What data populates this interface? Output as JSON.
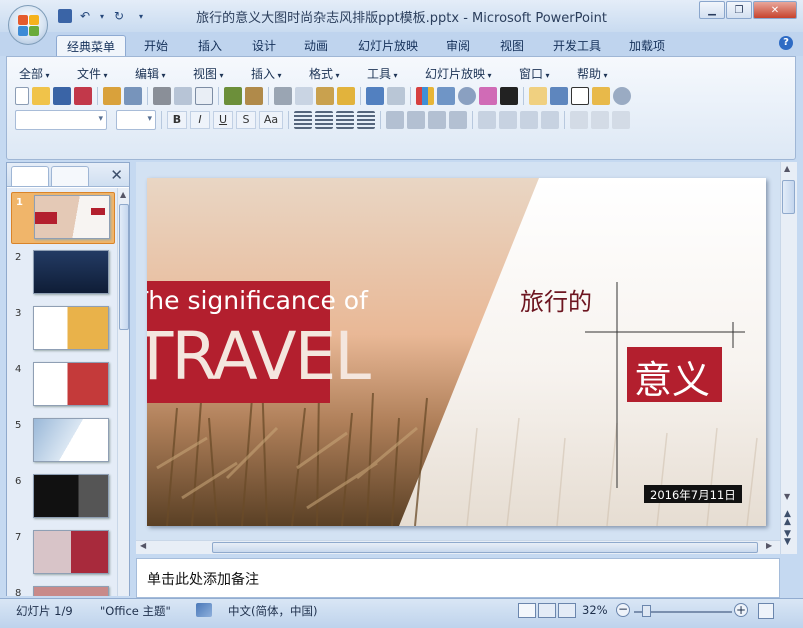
{
  "window": {
    "title": "旅行的意义大图时尚杂志风排版ppt模板.pptx - Microsoft PowerPoint",
    "minimize": "▭",
    "maximize": "❐",
    "close": "✕"
  },
  "quick_access": [
    "save-icon",
    "undo-icon",
    "redo-icon"
  ],
  "tabs": [
    {
      "label": "经典菜单",
      "active": true
    },
    {
      "label": "开始"
    },
    {
      "label": "插入"
    },
    {
      "label": "设计"
    },
    {
      "label": "动画"
    },
    {
      "label": "幻灯片放映"
    },
    {
      "label": "审阅"
    },
    {
      "label": "视图"
    },
    {
      "label": "开发工具"
    },
    {
      "label": "加载项"
    }
  ],
  "help": "?",
  "menu": [
    "全部",
    "文件",
    "编辑",
    "视图",
    "插入",
    "格式",
    "工具",
    "幻灯片放映",
    "窗口",
    "帮助"
  ],
  "format_buttons": [
    "B",
    "I",
    "U",
    "S",
    "Aa"
  ],
  "slide_panel": {
    "close": "✕",
    "slides": [
      "1",
      "2",
      "3",
      "4",
      "5",
      "6",
      "7",
      "8"
    ]
  },
  "slide": {
    "en_subtitle": "The significance of",
    "en_title": "TRAVEL",
    "cn_title_top": "旅行的",
    "cn_title_box": "意义",
    "date": "2016年7月11日",
    "colors": {
      "accent": "#b31f2e",
      "dark_red": "#6d1520",
      "date_bg": "#111111"
    }
  },
  "notes": {
    "placeholder": "单击此处添加备注"
  },
  "status": {
    "slide_info": "幻灯片 1/9",
    "theme": "\"Office 主题\"",
    "language": "中文(简体，中国)",
    "zoom": "32%"
  }
}
